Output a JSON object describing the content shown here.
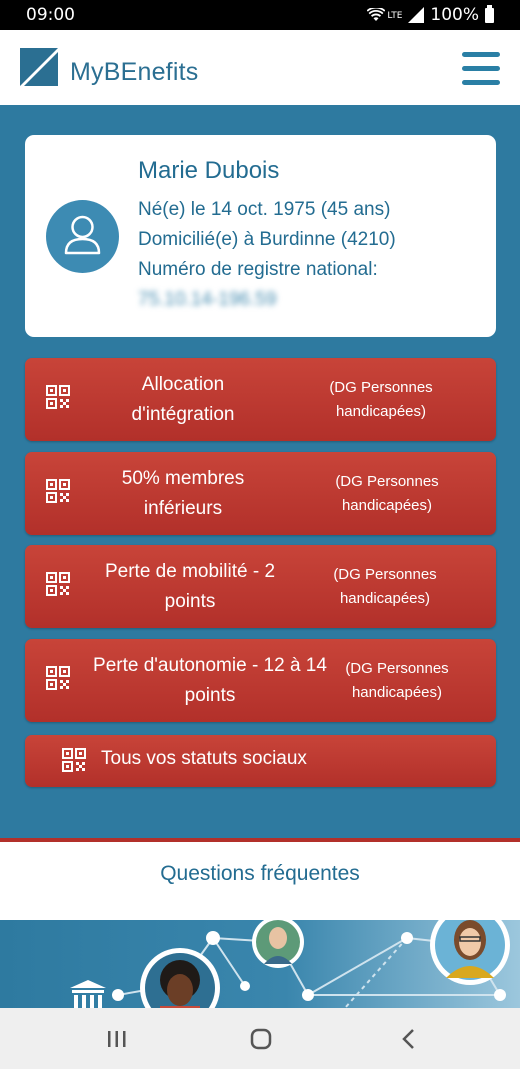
{
  "status_bar": {
    "time": "09:00",
    "network": "LTE",
    "battery": "100%"
  },
  "header": {
    "brand": "MyBEnefits",
    "menu_icon": "hamburger-menu-icon"
  },
  "profile": {
    "name": "Marie Dubois",
    "birth": "Né(e) le 14 oct. 1975 (45 ans)",
    "residence": "Domicilié(e) à Burdinne (4210)",
    "registry_label": "Numéro de registre national:",
    "registry_number": "75.10.14-196.59",
    "avatar_icon": "user-icon"
  },
  "statuses": [
    {
      "title": "Allocation d'intégration",
      "org": "(DG Personnes handicapées)",
      "icon": "qr-code-icon"
    },
    {
      "title": "50% membres inférieurs",
      "org": "(DG Personnes handicapées)",
      "icon": "qr-code-icon"
    },
    {
      "title": "Perte de mobilité - 2 points",
      "org": "(DG Personnes handicapées)",
      "icon": "qr-code-icon"
    },
    {
      "title": "Perte d'autonomie - 12 à 14 points",
      "org": "(DG Personnes handicapées)",
      "icon": "qr-code-icon"
    }
  ],
  "all_statuses": {
    "label": "Tous vos statuts sociaux",
    "icon": "qr-code-icon"
  },
  "faq": {
    "label": "Questions fréquentes"
  },
  "nav": {
    "recent_icon": "recent-apps-icon",
    "home_icon": "home-icon",
    "back_icon": "back-icon"
  },
  "colors": {
    "primary_blue": "#2e7aa0",
    "text_blue": "#236c91",
    "status_red": "#c0392b"
  }
}
